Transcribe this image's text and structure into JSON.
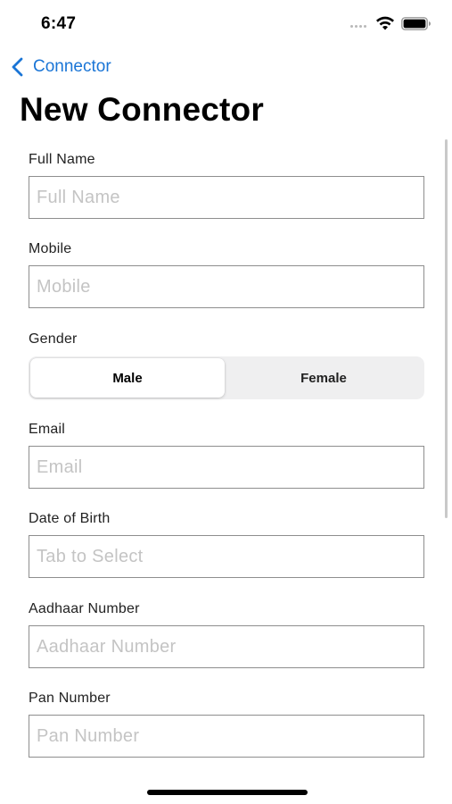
{
  "status_bar": {
    "time": "6:47",
    "icons": [
      "signal-dots-icon",
      "wifi-icon",
      "battery-icon"
    ]
  },
  "nav": {
    "back_label": "Connector",
    "title": "New Connector"
  },
  "colors": {
    "accent": "#1a75d6",
    "input_border": "#8e8e8e",
    "placeholder": "#c4c4c4",
    "segment_bg": "#efeff0"
  },
  "form": {
    "full_name": {
      "label": "Full Name",
      "placeholder": "Full Name",
      "value": ""
    },
    "mobile": {
      "label": "Mobile",
      "placeholder": "Mobile",
      "value": ""
    },
    "gender": {
      "label": "Gender",
      "options": [
        "Male",
        "Female"
      ],
      "selected": "Male"
    },
    "email": {
      "label": "Email",
      "placeholder": "Email",
      "value": ""
    },
    "dob": {
      "label": "Date of Birth",
      "placeholder": "Tab to Select",
      "value": ""
    },
    "aadhaar": {
      "label": "Aadhaar Number",
      "placeholder": "Aadhaar Number",
      "value": ""
    },
    "pan": {
      "label": "Pan Number",
      "placeholder": "Pan Number",
      "value": ""
    }
  }
}
